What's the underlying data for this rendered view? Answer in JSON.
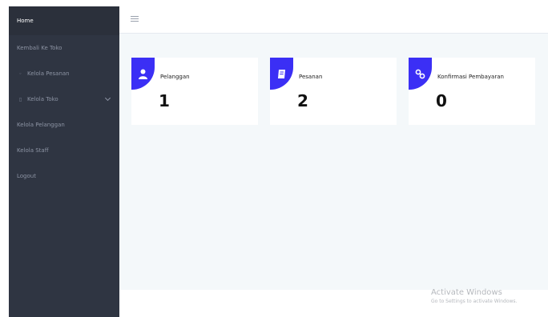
{
  "sidebar": {
    "items": [
      {
        "label": "Home"
      },
      {
        "label": "Kembali Ke Toko"
      },
      {
        "label": "Kelola Pesanan"
      },
      {
        "label": "Kelola Toko"
      },
      {
        "label": "Kelola Pelanggan"
      },
      {
        "label": "Kelola Staff"
      },
      {
        "label": "Logout"
      }
    ]
  },
  "cards": [
    {
      "label": "Pelanggan",
      "value": "1",
      "icon": "user-icon"
    },
    {
      "label": "Pesanan",
      "value": "2",
      "icon": "book-icon"
    },
    {
      "label": "Konfirmasi Pembayaran",
      "value": "0",
      "icon": "link-icon"
    }
  ],
  "watermark": {
    "title": "Activate Windows",
    "subtitle": "Go to Settings to activate Windows."
  },
  "colors": {
    "sidebar": "#2f3542",
    "accent": "#3b2ff5",
    "main_bg": "#f4f8fa"
  }
}
